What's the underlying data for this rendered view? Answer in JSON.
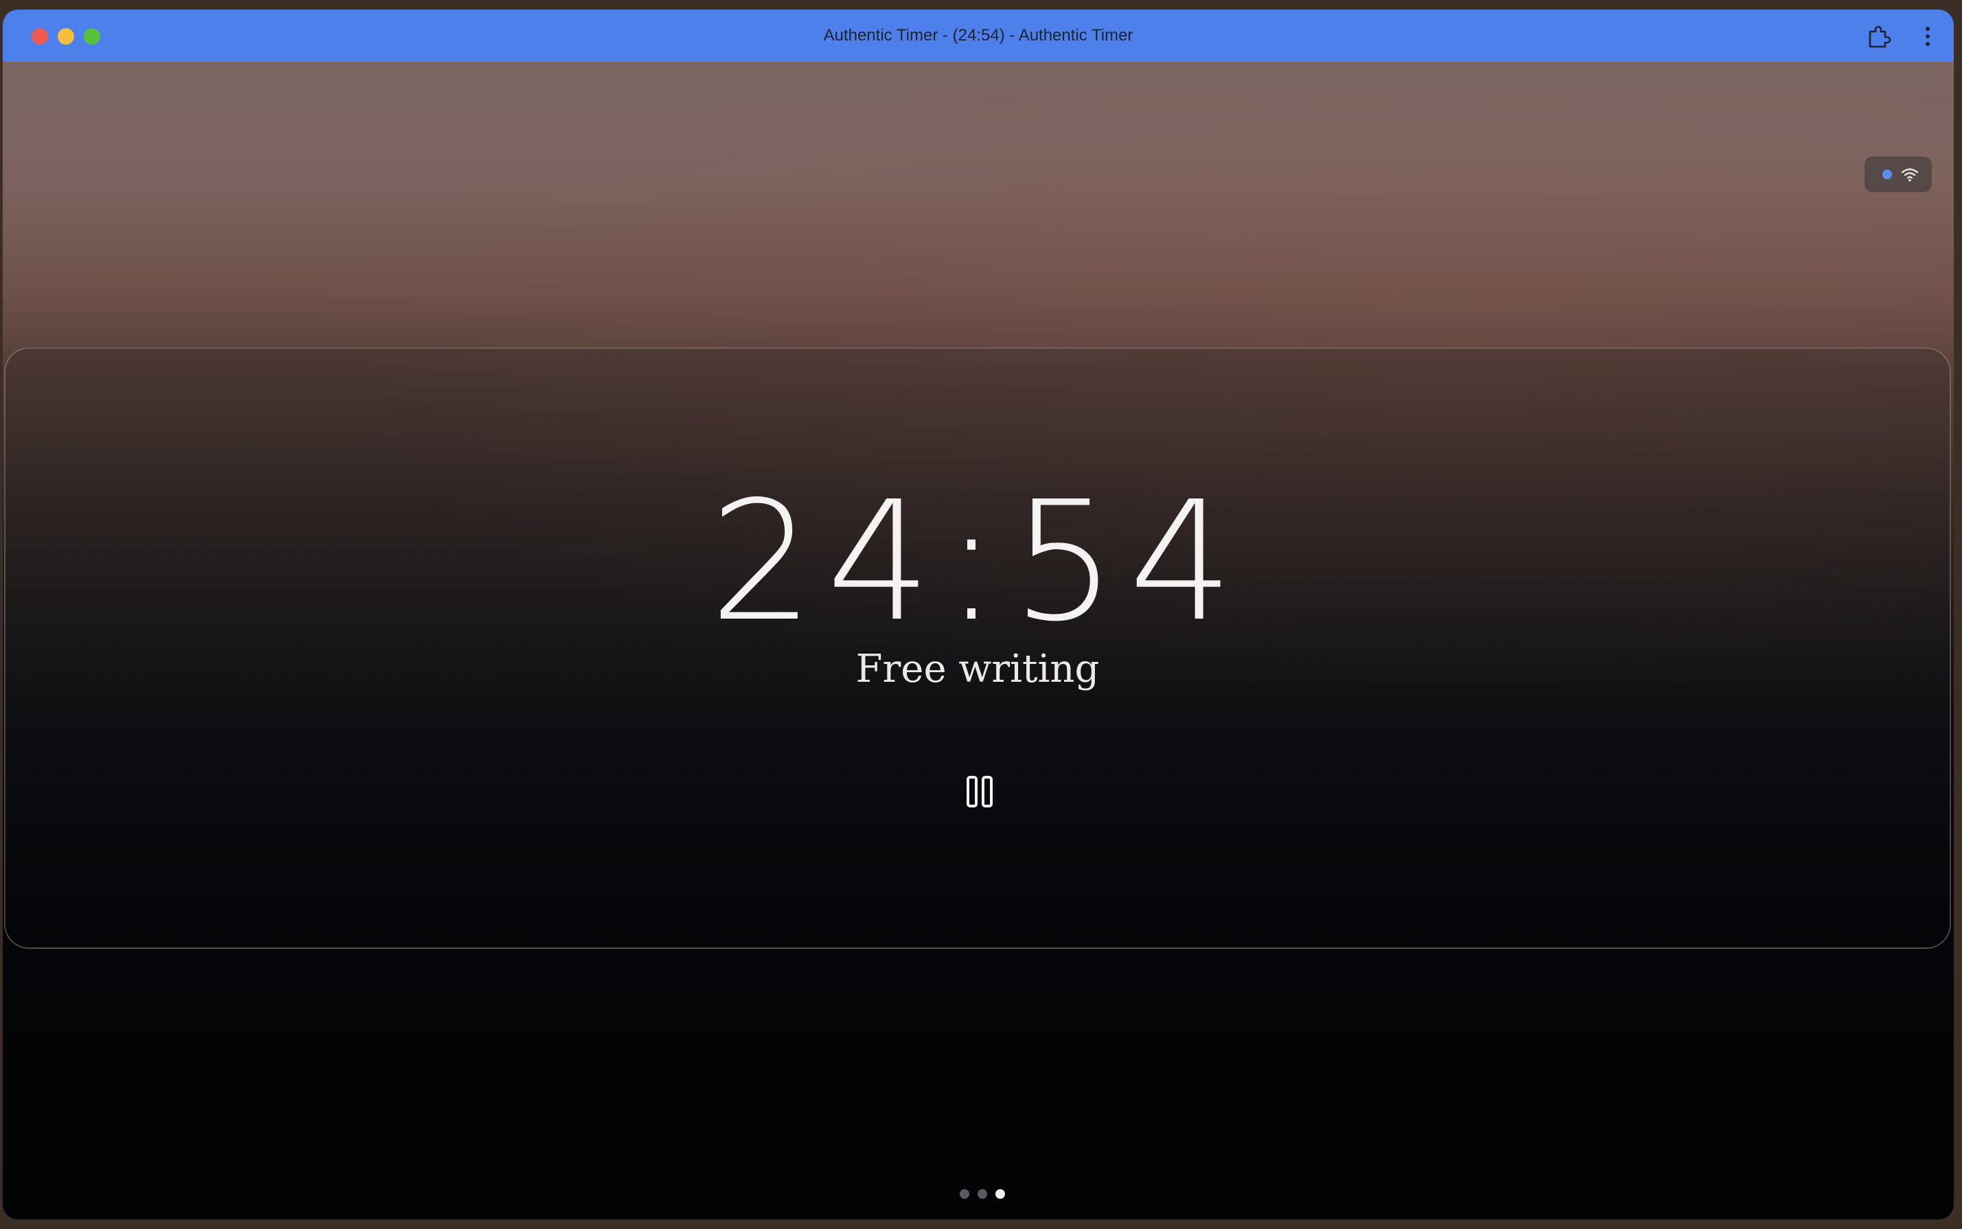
{
  "window": {
    "title": "Authentic Timer - (24:54) - Authentic Timer"
  },
  "icons": {
    "extensions": "puzzle-icon",
    "menu": "more-vertical-icon",
    "connection": "wifi-icon",
    "pause": "pause-icon"
  },
  "status": {
    "dot_color": "#5b8df0"
  },
  "timer": {
    "time": "24:54",
    "label": "Free writing"
  },
  "pagination": {
    "total": 3,
    "active_index": 3
  },
  "colors": {
    "titlebar": "#4d80ea",
    "close": "#ee5a52",
    "minimize": "#f5be3c",
    "maximize": "#57c13c"
  }
}
